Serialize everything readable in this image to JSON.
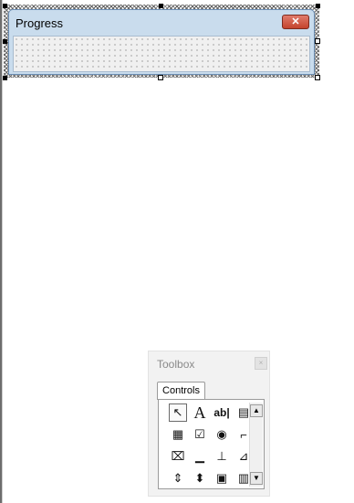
{
  "userform": {
    "title": "Progress",
    "close_glyph": "✕"
  },
  "toolbox": {
    "title": "Toolbox",
    "close_glyph": "×",
    "tabs": [
      {
        "label": "Controls"
      }
    ],
    "controls": [
      {
        "name": "select-objects-icon",
        "glyph": "↖"
      },
      {
        "name": "label-icon",
        "glyph": "A"
      },
      {
        "name": "textbox-icon",
        "glyph": "ab|"
      },
      {
        "name": "combobox-icon",
        "glyph": "▤"
      },
      {
        "name": "listbox-icon",
        "glyph": "▦"
      },
      {
        "name": "checkbox-icon",
        "glyph": "☑"
      },
      {
        "name": "optionbutton-icon",
        "glyph": "◉"
      },
      {
        "name": "togglebutton-icon",
        "glyph": "⌐"
      },
      {
        "name": "frame-icon",
        "glyph": "⌧"
      },
      {
        "name": "commandbutton-icon",
        "glyph": "▁"
      },
      {
        "name": "tabstrip-icon",
        "glyph": "⊥"
      },
      {
        "name": "multipage-icon",
        "glyph": "⊿"
      },
      {
        "name": "scrollbar-icon",
        "glyph": "⇕"
      },
      {
        "name": "spinbutton-icon",
        "glyph": "⬍"
      },
      {
        "name": "image-icon",
        "glyph": "▣"
      },
      {
        "name": "refedit-icon",
        "glyph": "▥"
      }
    ],
    "scroll_up_glyph": "▲",
    "scroll_down_glyph": "▼"
  }
}
